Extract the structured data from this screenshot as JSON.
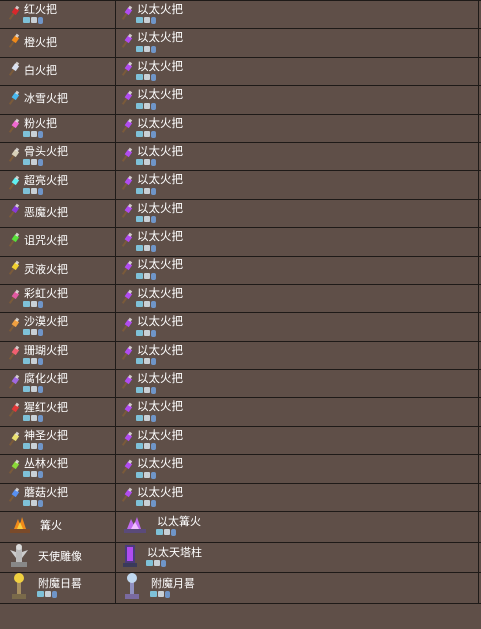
{
  "rows": [
    {
      "left": "红火把",
      "left_color": "#d8282c",
      "right": "以太火把",
      "right_color": "#b04cf0",
      "left_sub": true,
      "right_sub": true
    },
    {
      "left": "橙火把",
      "left_color": "#f08a1a",
      "right": "以太火把",
      "right_color": "#b04cf0",
      "left_sub": false,
      "right_sub": true
    },
    {
      "left": "白火把",
      "left_color": "#d8e0f0",
      "right": "以太火把",
      "right_color": "#b04cf0",
      "left_sub": false,
      "right_sub": true
    },
    {
      "left": "冰雪火把",
      "left_color": "#48b8f0",
      "right": "以太火把",
      "right_color": "#b04cf0",
      "left_sub": false,
      "right_sub": true
    },
    {
      "left": "粉火把",
      "left_color": "#f06ad0",
      "right": "以太火把",
      "right_color": "#b04cf0",
      "left_sub": true,
      "right_sub": true
    },
    {
      "left": "骨头火把",
      "left_color": "#d8d0b8",
      "right": "以太火把",
      "right_color": "#b04cf0",
      "left_sub": true,
      "right_sub": true
    },
    {
      "left": "超亮火把",
      "left_color": "#60f0f0",
      "right": "以太火把",
      "right_color": "#b04cf0",
      "left_sub": true,
      "right_sub": true
    },
    {
      "left": "恶魔火把",
      "left_color": "#8a3ad8",
      "right": "以太火把",
      "right_color": "#b04cf0",
      "left_sub": false,
      "right_sub": true
    },
    {
      "left": "诅咒火把",
      "left_color": "#58e03a",
      "right": "以太火把",
      "right_color": "#b04cf0",
      "left_sub": false,
      "right_sub": true
    },
    {
      "left": "灵液火把",
      "left_color": "#f0d030",
      "right": "以太火把",
      "right_color": "#b04cf0",
      "left_sub": false,
      "right_sub": true
    },
    {
      "left": "彩虹火把",
      "left_color": "#e05aa0",
      "right": "以太火把",
      "right_color": "#b04cf0",
      "left_sub": true,
      "right_sub": true
    },
    {
      "left": "沙漠火把",
      "left_color": "#f0a040",
      "right": "以太火把",
      "right_color": "#b04cf0",
      "left_sub": true,
      "right_sub": true
    },
    {
      "left": "珊瑚火把",
      "left_color": "#f06070",
      "right": "以太火把",
      "right_color": "#b04cf0",
      "left_sub": true,
      "right_sub": true
    },
    {
      "left": "腐化火把",
      "left_color": "#a068e0",
      "right": "以太火把",
      "right_color": "#b04cf0",
      "left_sub": true,
      "right_sub": true
    },
    {
      "left": "猩红火把",
      "left_color": "#e03838",
      "right": "以太火把",
      "right_color": "#b04cf0",
      "left_sub": true,
      "right_sub": true
    },
    {
      "left": "神圣火把",
      "left_color": "#e8e070",
      "right": "以太火把",
      "right_color": "#b04cf0",
      "left_sub": true,
      "right_sub": true
    },
    {
      "left": "丛林火把",
      "left_color": "#8ad838",
      "right": "以太火把",
      "right_color": "#b04cf0",
      "left_sub": true,
      "right_sub": true
    },
    {
      "left": "蘑菇火把",
      "left_color": "#5890f0",
      "right": "以太火把",
      "right_color": "#b04cf0",
      "left_sub": true,
      "right_sub": true
    }
  ],
  "special_rows": [
    {
      "left": "篝火",
      "left_icon": "campfire-icon",
      "right": "以太篝火",
      "right_icon": "aether-campfire-icon",
      "left_sub": false,
      "right_sub": true
    },
    {
      "left": "天使雕像",
      "left_icon": "angel-statue-icon",
      "right": "以太天塔柱",
      "right_icon": "aether-monolith-icon",
      "left_sub": false,
      "right_sub": true
    },
    {
      "left": "附魔日晷",
      "left_icon": "enchanted-sundial-icon",
      "right": "附魔月晷",
      "right_icon": "enchanted-moondial-icon",
      "left_sub": true,
      "right_sub": true
    }
  ],
  "colors": {
    "background": "#5f4f48",
    "border": "#1e1a18",
    "text": "#ffffff",
    "aether_highlight": "#b04cf0"
  }
}
